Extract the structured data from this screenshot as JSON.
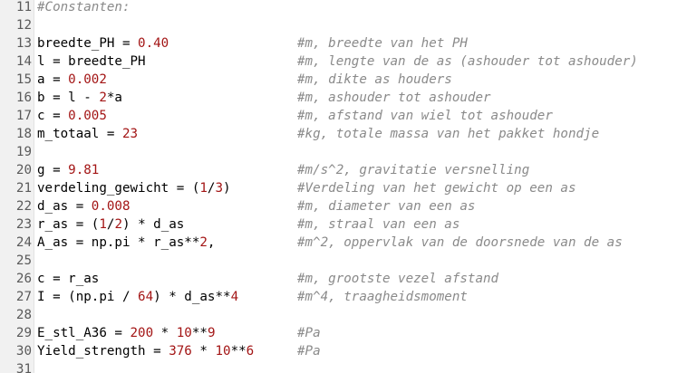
{
  "lines": [
    {
      "n": "11",
      "code": [],
      "comment": "",
      "full_comment": "#Constanten:"
    },
    {
      "n": "12",
      "code": [],
      "comment": ""
    },
    {
      "n": "13",
      "code": [
        {
          "t": "breedte_PH = "
        },
        {
          "t": "0.40",
          "num": true
        }
      ],
      "comment": "#m, breedte van het PH"
    },
    {
      "n": "14",
      "code": [
        {
          "t": "l = breedte_PH"
        }
      ],
      "comment": "#m, lengte van de as (ashouder tot ashouder)"
    },
    {
      "n": "15",
      "code": [
        {
          "t": "a = "
        },
        {
          "t": "0.002",
          "num": true
        }
      ],
      "comment": "#m, dikte as houders"
    },
    {
      "n": "16",
      "code": [
        {
          "t": "b = l - "
        },
        {
          "t": "2",
          "num": true
        },
        {
          "t": "*a"
        }
      ],
      "comment": "#m, ashouder tot ashouder"
    },
    {
      "n": "17",
      "code": [
        {
          "t": "c = "
        },
        {
          "t": "0.005",
          "num": true
        }
      ],
      "comment": "#m, afstand van wiel tot ashouder"
    },
    {
      "n": "18",
      "code": [
        {
          "t": "m_totaal = "
        },
        {
          "t": "23",
          "num": true
        }
      ],
      "comment": "#kg, totale massa van het pakket hondje"
    },
    {
      "n": "19",
      "code": [],
      "comment": ""
    },
    {
      "n": "20",
      "code": [
        {
          "t": "g = "
        },
        {
          "t": "9.81",
          "num": true
        }
      ],
      "comment": "#m/s^2, gravitatie versnelling"
    },
    {
      "n": "21",
      "code": [
        {
          "t": "verdeling_gewicht = ("
        },
        {
          "t": "1",
          "num": true
        },
        {
          "t": "/"
        },
        {
          "t": "3",
          "num": true
        },
        {
          "t": ")"
        }
      ],
      "comment": "#Verdeling van het gewicht op een as"
    },
    {
      "n": "22",
      "code": [
        {
          "t": "d_as = "
        },
        {
          "t": "0.008",
          "num": true
        }
      ],
      "comment": "#m, diameter van een as"
    },
    {
      "n": "23",
      "code": [
        {
          "t": "r_as = ("
        },
        {
          "t": "1",
          "num": true
        },
        {
          "t": "/"
        },
        {
          "t": "2",
          "num": true
        },
        {
          "t": ") * d_as"
        }
      ],
      "comment": "#m, straal van een as"
    },
    {
      "n": "24",
      "code": [
        {
          "t": "A_as = np.pi * r_as**"
        },
        {
          "t": "2",
          "num": true
        },
        {
          "t": ","
        }
      ],
      "comment": "#m^2, oppervlak van de doorsnede van de as"
    },
    {
      "n": "25",
      "code": [],
      "comment": ""
    },
    {
      "n": "26",
      "code": [
        {
          "t": "c = r_as"
        }
      ],
      "comment": "#m, grootste vezel afstand"
    },
    {
      "n": "27",
      "code": [
        {
          "t": "I = (np.pi / "
        },
        {
          "t": "64",
          "num": true
        },
        {
          "t": ") * d_as**"
        },
        {
          "t": "4",
          "num": true
        }
      ],
      "comment": "#m^4, traagheidsmoment"
    },
    {
      "n": "28",
      "code": [],
      "comment": ""
    },
    {
      "n": "29",
      "code": [
        {
          "t": "E_stl_A36 = "
        },
        {
          "t": "200",
          "num": true
        },
        {
          "t": " * "
        },
        {
          "t": "10",
          "num": true
        },
        {
          "t": "**"
        },
        {
          "t": "9",
          "num": true
        }
      ],
      "comment": "#Pa"
    },
    {
      "n": "30",
      "code": [
        {
          "t": "Yield_strength = "
        },
        {
          "t": "376",
          "num": true
        },
        {
          "t": " * "
        },
        {
          "t": "10",
          "num": true
        },
        {
          "t": "**"
        },
        {
          "t": "6",
          "num": true
        }
      ],
      "comment": "#Pa"
    },
    {
      "n": "31",
      "code": [],
      "comment": ""
    }
  ],
  "colors": {
    "number": "#a31515",
    "comment": "#8a8a8a",
    "text": "#000000",
    "gutter": "#f1f1f1"
  }
}
